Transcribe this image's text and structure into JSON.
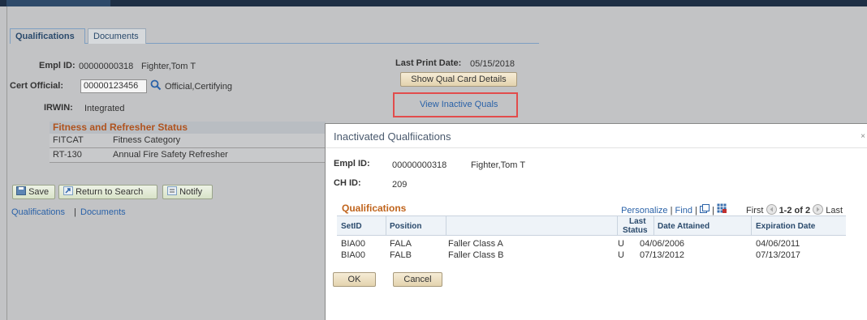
{
  "tabs": [
    {
      "label": "Qualifications",
      "active": true
    },
    {
      "label": "Documents",
      "active": false
    }
  ],
  "employee": {
    "empl_id_label": "Empl ID:",
    "empl_id": "00000000318",
    "name": "Fighter,Tom T",
    "cert_official_label": "Cert Official:",
    "cert_official_id": "00000123456",
    "cert_official_name": "Official,Certifying",
    "irwin_label": "IRWIN:",
    "irwin_value": "Integrated"
  },
  "print": {
    "last_print_date_label": "Last Print Date:",
    "last_print_date": "05/15/2018",
    "show_qual_card_button": "Show Qual Card Details",
    "view_inactive_link": "View Inactive Quals"
  },
  "fitness": {
    "title": "Fitness and Refresher Status",
    "rows": [
      {
        "code": "FITCAT",
        "description": "Fitness Category"
      },
      {
        "code": "RT-130",
        "description": "Annual Fire Safety Refresher"
      }
    ]
  },
  "toolbar": {
    "save": "Save",
    "return_to_search": "Return to Search",
    "notify": "Notify"
  },
  "footer_links": {
    "qualifications": "Qualifications",
    "separator": "|",
    "documents": "Documents"
  },
  "modal": {
    "title": "Inactivated Qualfiications",
    "close": "×",
    "empl_id_label": "Empl ID:",
    "empl_id": "00000000318",
    "name": "Fighter,Tom T",
    "ch_id_label": "CH ID:",
    "ch_id": "209",
    "grid": {
      "title": "Qualifications",
      "personalize": "Personalize",
      "find": "Find",
      "sep": "|",
      "first": "First",
      "range": "1-2 of 2",
      "last": "Last",
      "columns": {
        "setid": "SetID",
        "position": "Position",
        "last_status_1": "Last",
        "last_status_2": "Status",
        "date_attained": "Date Attained",
        "expiration_date": "Expiration Date"
      },
      "rows": [
        {
          "setid": "BIA00",
          "position": "FALA",
          "description": "Faller Class A",
          "status": "U",
          "date_attained": "04/06/2006",
          "expiration": "04/06/2011"
        },
        {
          "setid": "BIA00",
          "position": "FALB",
          "description": "Faller Class B",
          "status": "U",
          "date_attained": "07/13/2012",
          "expiration": "07/13/2017"
        }
      ]
    },
    "ok_button": "OK",
    "cancel_button": "Cancel"
  },
  "colors": {
    "accent_orange": "#c0641c",
    "link_blue": "#2a62a8",
    "highlight_red": "#e24c4c",
    "header_dark": "#1e2f45"
  }
}
